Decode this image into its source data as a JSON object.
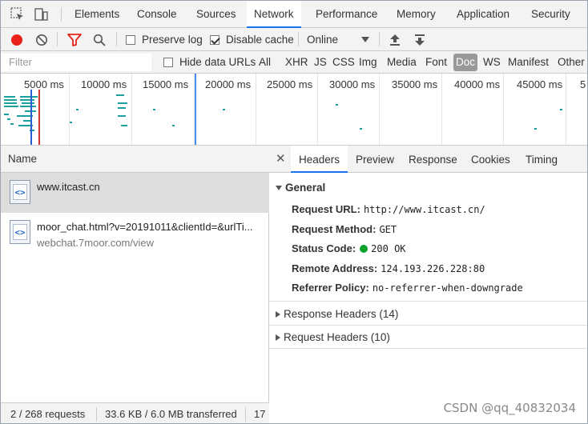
{
  "top_tabs": [
    "Elements",
    "Console",
    "Sources",
    "Network",
    "Performance",
    "Memory",
    "Application",
    "Security"
  ],
  "active_top_tab": "Network",
  "toolbar": {
    "preserve_log_label": "Preserve log",
    "preserve_log_checked": false,
    "disable_cache_label": "Disable cache",
    "disable_cache_checked": true,
    "throttle_value": "Online"
  },
  "filter": {
    "placeholder": "Filter",
    "hide_data_urls_label": "Hide data URLs",
    "types": [
      "All",
      "XHR",
      "JS",
      "CSS",
      "Img",
      "Media",
      "Font",
      "Doc",
      "WS",
      "Manifest",
      "Other"
    ],
    "active_type": "Doc"
  },
  "overview": {
    "ticks": [
      "5000 ms",
      "10000 ms",
      "15000 ms",
      "20000 ms",
      "25000 ms",
      "30000 ms",
      "35000 ms",
      "40000 ms",
      "45000 ms",
      "5"
    ]
  },
  "requests": {
    "column_header": "Name",
    "items": [
      {
        "name": "www.itcast.cn",
        "sub": ""
      },
      {
        "name": "moor_chat.html?v=20191011&clientId=&urlTi...",
        "sub": "webchat.7moor.com/view"
      }
    ]
  },
  "status": {
    "requests": "2 / 268 requests",
    "transferred": "33.6 KB / 6.0 MB transferred",
    "extra": "17"
  },
  "details": {
    "tabs": [
      "Headers",
      "Preview",
      "Response",
      "Cookies",
      "Timing"
    ],
    "active_tab": "Headers",
    "general_title": "General",
    "general": [
      {
        "key": "Request URL:",
        "value": "http://www.itcast.cn/"
      },
      {
        "key": "Request Method:",
        "value": "GET"
      },
      {
        "key": "Status Code:",
        "value": "200 OK"
      },
      {
        "key": "Remote Address:",
        "value": "124.193.226.228:80"
      },
      {
        "key": "Referrer Policy:",
        "value": "no-referrer-when-downgrade"
      }
    ],
    "response_headers": "Response Headers (14)",
    "request_headers": "Request Headers (10)"
  },
  "watermark": "CSDN @qq_40832034",
  "colors": {
    "accent": "#1a73e8",
    "record": "#e8221b",
    "status_ok": "#0aa12c",
    "bar": "#1ba0a0"
  }
}
